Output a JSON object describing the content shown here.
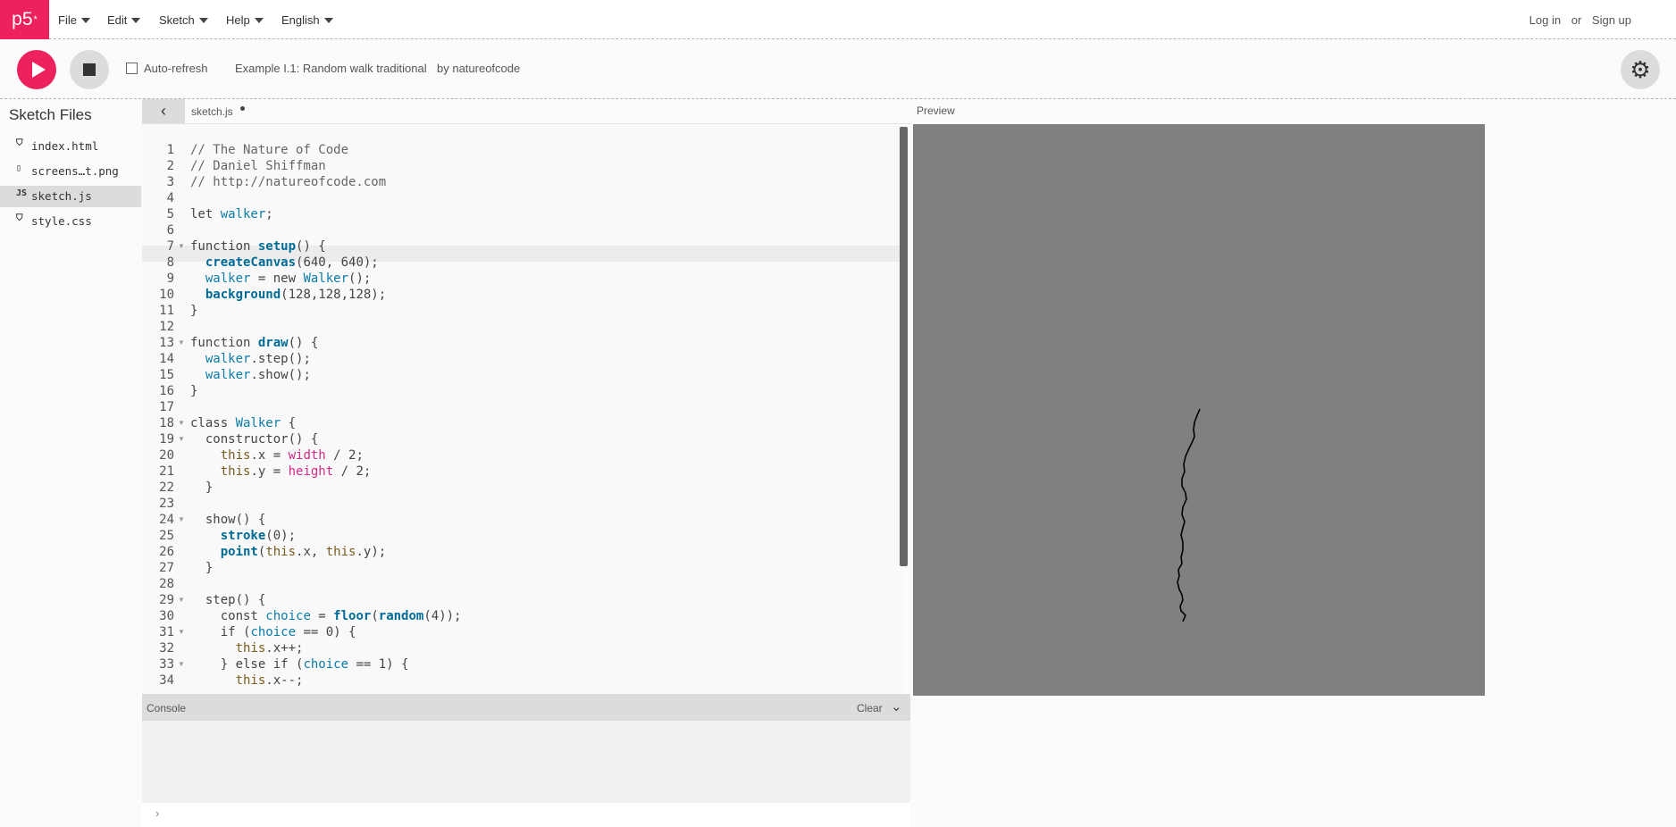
{
  "nav": {
    "logo": "p5",
    "logo_sup": "*",
    "menus": [
      "File",
      "Edit",
      "Sketch",
      "Help",
      "English"
    ],
    "login": "Log in",
    "or": "or",
    "signup": "Sign up"
  },
  "toolbar": {
    "auto_refresh": "Auto-refresh",
    "sketch_name": "Example I.1: Random walk traditional",
    "author": "by natureofcode"
  },
  "sidebar": {
    "title": "Sketch Files",
    "files": [
      {
        "name": "index.html",
        "icon": "html-file-icon",
        "selected": false
      },
      {
        "name": "screens…t.png",
        "icon": "image-file-icon",
        "selected": false
      },
      {
        "name": "sketch.js",
        "icon": "js-file-icon",
        "selected": true
      },
      {
        "name": "style.css",
        "icon": "css-file-icon",
        "selected": false
      }
    ]
  },
  "editor": {
    "tab": "sketch.js",
    "lines": [
      "",
      "// The Nature of Code",
      "// Daniel Shiffman",
      "// http://natureofcode.com",
      "",
      "let walker;",
      "",
      "function setup() {",
      "  createCanvas(640, 640);",
      "  walker = new Walker();",
      "  background(128,128,128);",
      "}",
      "",
      "function draw() {",
      "  walker.step();",
      "  walker.show();",
      "}",
      "",
      "class Walker {",
      "  constructor() {",
      "    this.x = width / 2;",
      "    this.y = height / 2;",
      "  }",
      "",
      "  show() {",
      "    stroke(0);",
      "    point(this.x, this.y);",
      "  }",
      "",
      "  step() {",
      "    const choice = floor(random(4));",
      "    if (choice == 0) {",
      "      this.x++;",
      "    } else if (choice == 1) {",
      "      this.x--;"
    ],
    "line_numbers": [
      "",
      "1",
      "2",
      "3",
      "4",
      "5",
      "6",
      "7",
      "8",
      "9",
      "10",
      "11",
      "12",
      "13",
      "14",
      "15",
      "16",
      "17",
      "18",
      "19",
      "20",
      "21",
      "22",
      "23",
      "24",
      "25",
      "26",
      "27",
      "28",
      "29",
      "30",
      "31",
      "32",
      "33",
      "34"
    ],
    "fold_lines": [
      7,
      13,
      18,
      19,
      24,
      29,
      31,
      33
    ],
    "highlight_line": 8
  },
  "console": {
    "title": "Console",
    "clear": "Clear",
    "prompt": "›"
  },
  "preview": {
    "label": "Preview",
    "background": "#808080"
  },
  "colors": {
    "accent": "#ed225d",
    "keyword_blue": "#0b7ca9",
    "fn_bold": "#006b97",
    "pink": "#d52889"
  }
}
